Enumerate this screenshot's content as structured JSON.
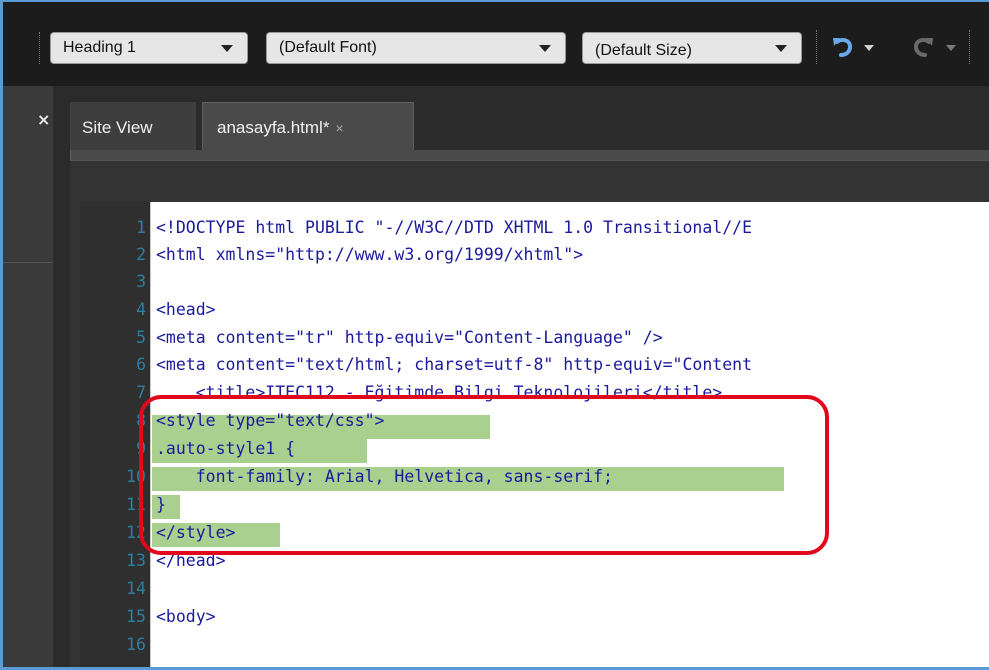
{
  "toolbar": {
    "paragraph_style": "Heading 1",
    "font": "(Default Font)",
    "size": "(Default Size)"
  },
  "panel": {
    "close_glyph": "×"
  },
  "tabs": [
    {
      "label": "Site View"
    },
    {
      "label": "anasayfa.html*",
      "close_glyph": "×"
    }
  ],
  "code_lines": [
    {
      "n": "1",
      "text": "<!DOCTYPE html PUBLIC \"-//W3C//DTD XHTML 1.0 Transitional//E"
    },
    {
      "n": "2",
      "text": "<html xmlns=\"http://www.w3.org/1999/xhtml\">"
    },
    {
      "n": "3",
      "text": ""
    },
    {
      "n": "4",
      "text": "<head>"
    },
    {
      "n": "5",
      "text": "<meta content=\"tr\" http-equiv=\"Content-Language\" />"
    },
    {
      "n": "6",
      "text": "<meta content=\"text/html; charset=utf-8\" http-equiv=\"Content"
    },
    {
      "n": "7",
      "text": "    <title>ITEC112 - Eğitimde Bilgi Teknolojileri</title>"
    },
    {
      "n": "8",
      "text": "<style type=\"text/css\">"
    },
    {
      "n": "9",
      "text": ".auto-style1 {"
    },
    {
      "n": "10",
      "text": "    font-family: Arial, Helvetica, sans-serif;"
    },
    {
      "n": "11",
      "text": "}"
    },
    {
      "n": "12",
      "text": "</style>"
    },
    {
      "n": "13",
      "text": "</head>"
    },
    {
      "n": "14",
      "text": ""
    },
    {
      "n": "15",
      "text": "<body>"
    },
    {
      "n": "16",
      "text": ""
    }
  ],
  "colors": {
    "highlight": "#a9d08e",
    "annotation_box": "#e0081a",
    "frame": "#5b9bd5"
  },
  "icons": [
    "undo-icon",
    "redo-icon",
    "close-icon",
    "chevron-down-icon"
  ]
}
